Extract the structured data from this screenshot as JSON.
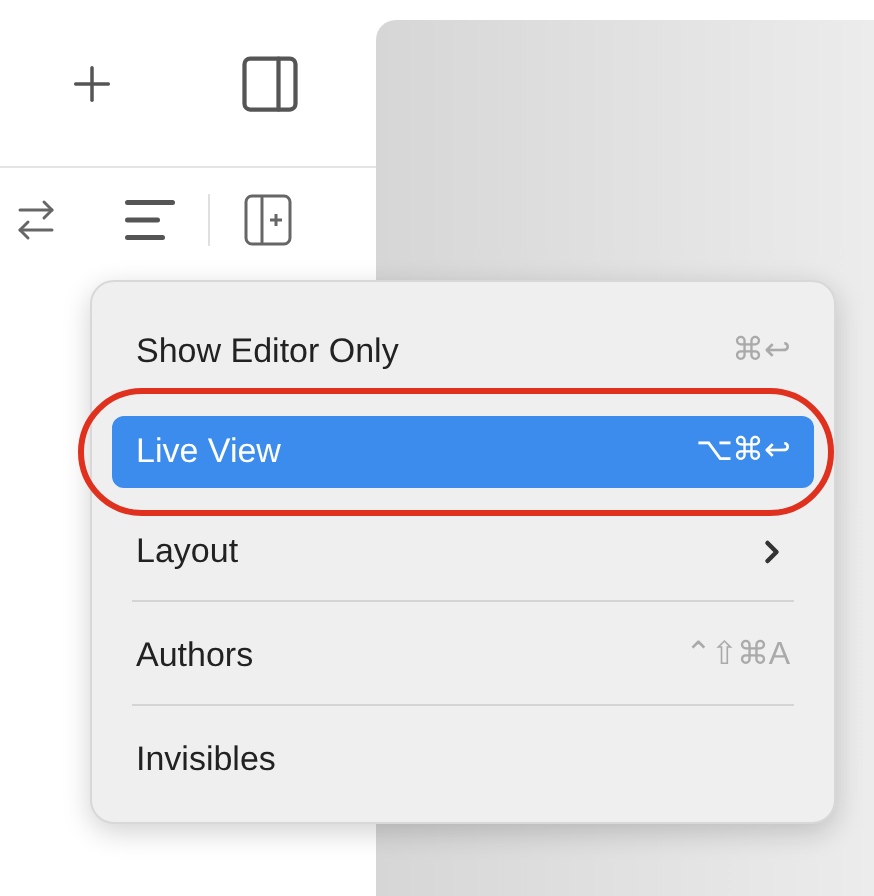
{
  "menu": {
    "sections": [
      {
        "items": [
          {
            "label": "Show Editor Only",
            "kind": "action",
            "shortcut": "⌘↩",
            "selected": false,
            "circled": false
          },
          {
            "label": "Live View",
            "kind": "action",
            "shortcut": "⌥⌘↩",
            "selected": true,
            "circled": true
          },
          {
            "label": "Layout",
            "kind": "submenu",
            "selected": false,
            "circled": false
          }
        ]
      },
      {
        "items": [
          {
            "label": "Authors",
            "kind": "action",
            "shortcut": "⌃⇧⌘A",
            "selected": false,
            "circled": false
          }
        ]
      },
      {
        "items": [
          {
            "label": "Invisibles",
            "kind": "action",
            "selected": false,
            "circled": false
          }
        ]
      }
    ]
  }
}
